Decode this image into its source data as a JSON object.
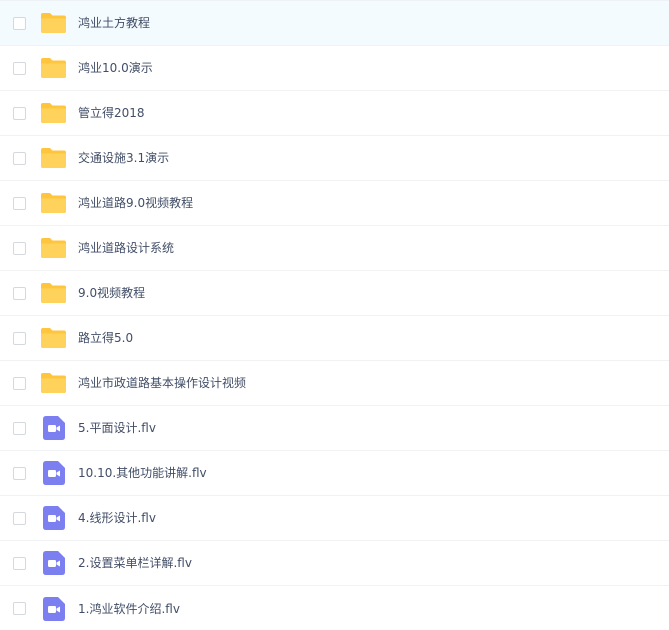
{
  "files": [
    {
      "name": "鸿业土方教程",
      "type": "folder",
      "icon": "folder-icon",
      "selected": false
    },
    {
      "name": "鸿业10.0演示",
      "type": "folder",
      "icon": "folder-icon",
      "selected": false
    },
    {
      "name": "管立得2018",
      "type": "folder",
      "icon": "folder-icon",
      "selected": false
    },
    {
      "name": "交通设施3.1演示",
      "type": "folder",
      "icon": "folder-icon",
      "selected": false
    },
    {
      "name": "鸿业道路9.0视频教程",
      "type": "folder",
      "icon": "folder-icon",
      "selected": false
    },
    {
      "name": "鸿业道路设计系统",
      "type": "folder",
      "icon": "folder-icon",
      "selected": false
    },
    {
      "name": "9.0视频教程",
      "type": "folder",
      "icon": "folder-icon",
      "selected": false
    },
    {
      "name": "路立得5.0",
      "type": "folder",
      "icon": "folder-icon",
      "selected": false
    },
    {
      "name": "鸿业市政道路基本操作设计视频",
      "type": "folder",
      "icon": "folder-icon",
      "selected": false
    },
    {
      "name": "5.平面设计.flv",
      "type": "video",
      "icon": "video-file-icon",
      "selected": false
    },
    {
      "name": "10.10.其他功能讲解.flv",
      "type": "video",
      "icon": "video-file-icon",
      "selected": false
    },
    {
      "name": "4.线形设计.flv",
      "type": "video",
      "icon": "video-file-icon",
      "selected": false
    },
    {
      "name": "2.设置菜单栏详解.flv",
      "type": "video",
      "icon": "video-file-icon",
      "selected": false
    },
    {
      "name": "1.鸿业软件介绍.flv",
      "type": "video",
      "icon": "video-file-icon",
      "selected": false
    }
  ],
  "colors": {
    "folder": "#ffd25c",
    "folder_tab": "#ffc53d",
    "video": "#7b7ff0",
    "hover_row": "#f4fbff",
    "text": "#424e67"
  }
}
